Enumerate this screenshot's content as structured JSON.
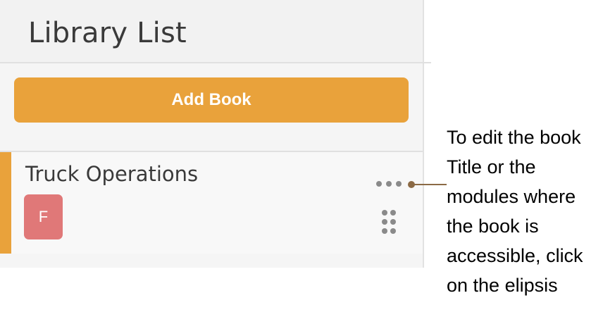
{
  "panel": {
    "title": "Library List",
    "add_button_label": "Add Book"
  },
  "book": {
    "title": "Truck Operations",
    "avatar_initial": "F",
    "menu_icon": "ellipsis-icon",
    "drag_icon": "drag-handle-icon"
  },
  "annotation": {
    "text": "To edit the book Title or the modules where the book is accessible, click on the elipsis"
  },
  "colors": {
    "accent": "#e9a23b",
    "avatar": "#e07878",
    "connector": "#8b6a45"
  }
}
